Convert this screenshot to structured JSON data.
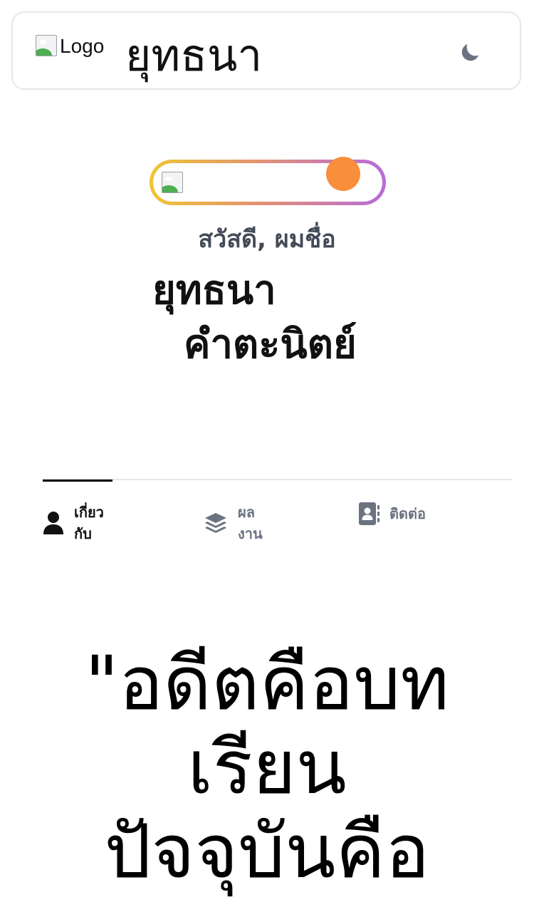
{
  "header": {
    "logo_alt": "Logo",
    "title": "ยุทธนา",
    "theme_toggle_icon": "moon-icon"
  },
  "hero": {
    "greeting": "สวัสดี, ผมชื่อ",
    "first_name": "ยุทธนา",
    "last_name": "คำตะนิตย์",
    "accent_gradient": [
      "#efc533",
      "#e49370",
      "#b86bd9"
    ],
    "status_dot_color": "#f98e3c"
  },
  "tabs": [
    {
      "label": "เกี่ยว\nกับ",
      "icon": "user-icon",
      "active": true
    },
    {
      "label": "ผล\nงาน",
      "icon": "layers-icon",
      "active": false
    },
    {
      "label": "ติดต่อ",
      "icon": "contact-book-icon",
      "active": false
    }
  ],
  "quote": {
    "text": "\"อดีตคือบท\nเรียน\nปัจจุบันคือ"
  }
}
